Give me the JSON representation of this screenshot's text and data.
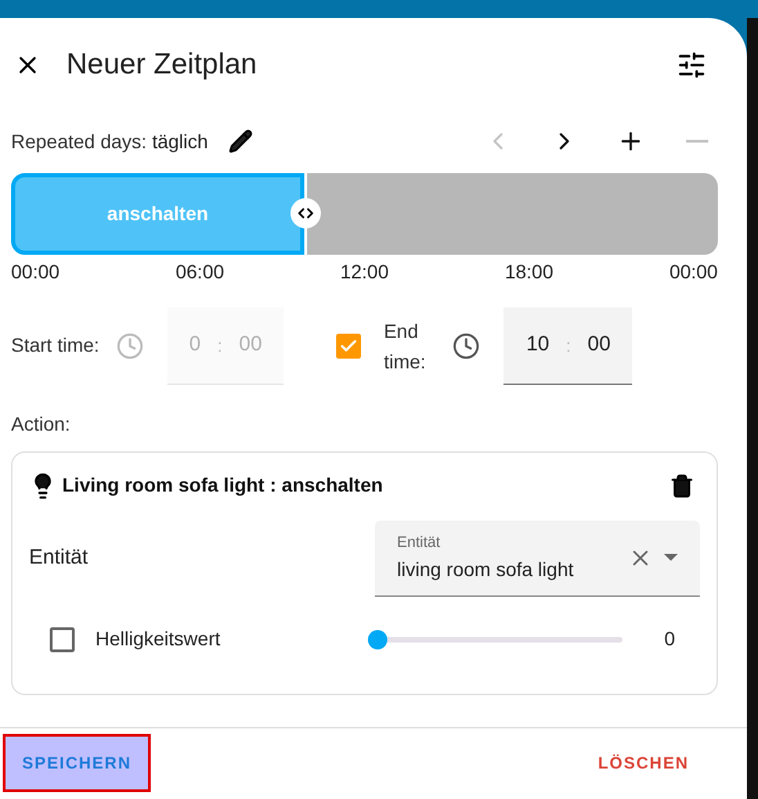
{
  "dialog": {
    "title": "Neuer Zeitplan"
  },
  "repeat": {
    "label": "Repeated days:",
    "value": "täglich"
  },
  "nav": [
    {
      "kind": "prev",
      "disabled": true
    },
    {
      "kind": "next",
      "disabled": false
    },
    {
      "kind": "add",
      "disabled": false
    },
    {
      "kind": "remove",
      "disabled": true
    }
  ],
  "segments": [
    {
      "label": "anschalten",
      "selected": true
    },
    {
      "selected": false
    }
  ],
  "ticks": [
    "00:00",
    "06:00",
    "12:00",
    "18:00",
    "00:00"
  ],
  "start_time": {
    "label": "Start time:",
    "hours": "0",
    "separator": ":",
    "minutes": "00",
    "disabled": true
  },
  "end_time": {
    "label": "End time:",
    "hours": "10",
    "separator": ":",
    "minutes": "00",
    "checked": true,
    "disabled": false
  },
  "action": {
    "label": "Action:",
    "title": "Living room sofa light : anschalten",
    "entity_label": "Entität",
    "entity_field": {
      "label": "Entität",
      "value": "living room sofa light"
    },
    "brightness": {
      "label": "Helligkeitswert",
      "checked": false,
      "level": 0,
      "reading": "0"
    }
  },
  "buttons": [
    {
      "kind": "save",
      "label": "SPEICHERN",
      "focused": true
    },
    {
      "kind": "delete",
      "label": "LÖSCHEN",
      "focused": false
    }
  ]
}
